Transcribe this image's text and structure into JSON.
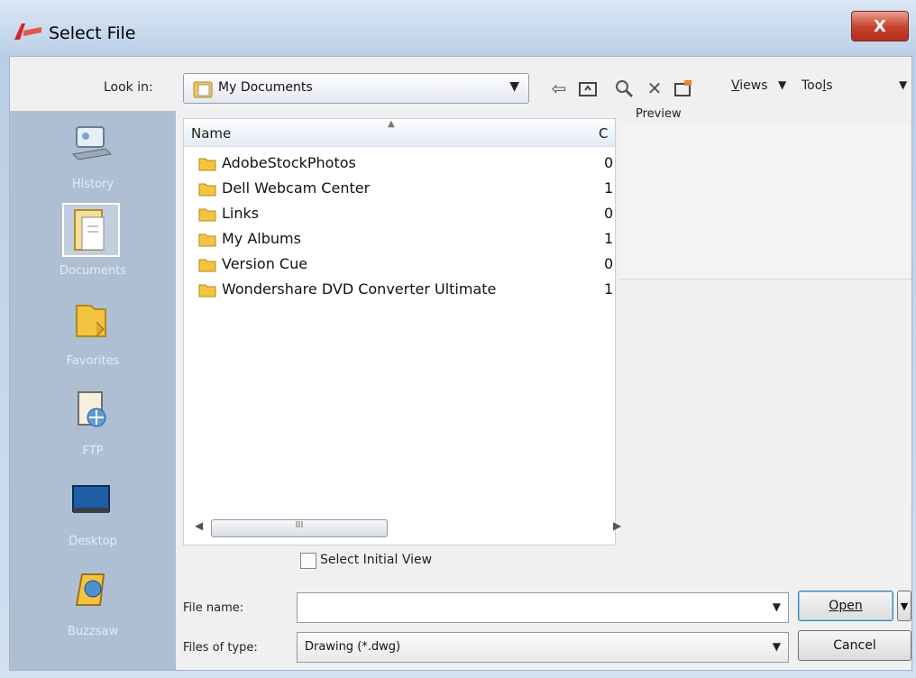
{
  "window": {
    "title": "Select File",
    "close_label": "X"
  },
  "toolbar": {
    "look_in_label": "Look in:",
    "look_in_value": "My Documents",
    "back_icon": "back-arrow-icon",
    "up_icon": "up-folder-icon",
    "search_icon": "search-web-icon",
    "delete_icon": "delete-icon",
    "new_folder_icon": "new-folder-icon",
    "views_label": "Views",
    "tools_label": "Tools"
  },
  "places": [
    {
      "label": "History",
      "icon": "history-icon"
    },
    {
      "label": "Documents",
      "icon": "documents-icon",
      "selected": true
    },
    {
      "label": "Favorites",
      "icon": "favorites-icon"
    },
    {
      "label": "FTP",
      "icon": "ftp-icon"
    },
    {
      "label": "Desktop",
      "icon": "desktop-icon"
    },
    {
      "label": "Buzzsaw",
      "icon": "buzzsaw-icon"
    }
  ],
  "file_list": {
    "columns": {
      "name": "Name",
      "second": "C"
    },
    "rows": [
      {
        "name": "AdobeStockPhotos",
        "second": "0"
      },
      {
        "name": "Dell Webcam Center",
        "second": "1"
      },
      {
        "name": "Links",
        "second": "0"
      },
      {
        "name": "My Albums",
        "second": "1"
      },
      {
        "name": "Version Cue",
        "second": "0"
      },
      {
        "name": "Wondershare DVD Converter Ultimate",
        "second": "1"
      }
    ],
    "scroll_thumb": "III"
  },
  "preview": {
    "label": "Preview"
  },
  "bottom": {
    "select_initial_view_label": "Select Initial View",
    "select_initial_view_checked": false,
    "file_name_label": "File name:",
    "file_name_value": "",
    "files_of_type_label": "Files of type:",
    "files_of_type_value": "Drawing (*.dwg)",
    "open_label": "Open",
    "cancel_label": "Cancel"
  },
  "colors": {
    "title_bar": "#c4d6ec",
    "places_bar": "#aebfd3",
    "close_button": "#c4402a"
  }
}
